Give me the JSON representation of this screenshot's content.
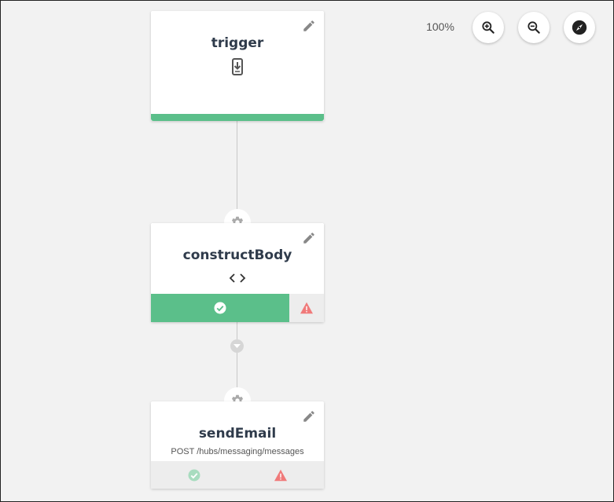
{
  "toolbar": {
    "zoom_level": "100%",
    "zoom_in_icon": "zoom-in-icon",
    "zoom_out_icon": "zoom-out-icon",
    "fit_view_icon": "compass-icon"
  },
  "nodes": [
    {
      "title": "trigger",
      "icon": "mobile-download-icon",
      "status_color": "#5bbf8a"
    },
    {
      "title": "constructBody",
      "icon": "code-icon",
      "status": {
        "success_icon": "check-circle-icon",
        "warning_icon": "warning-icon"
      }
    },
    {
      "title": "sendEmail",
      "subtitle": "POST /hubs/messaging/messages",
      "status": {
        "success_icon": "check-circle-icon",
        "warning_icon": "warning-icon"
      }
    }
  ],
  "colors": {
    "success": "#5bbf8a",
    "warning": "#f07a7a",
    "title": "#2f3b4b",
    "background": "#f2f2f2"
  }
}
